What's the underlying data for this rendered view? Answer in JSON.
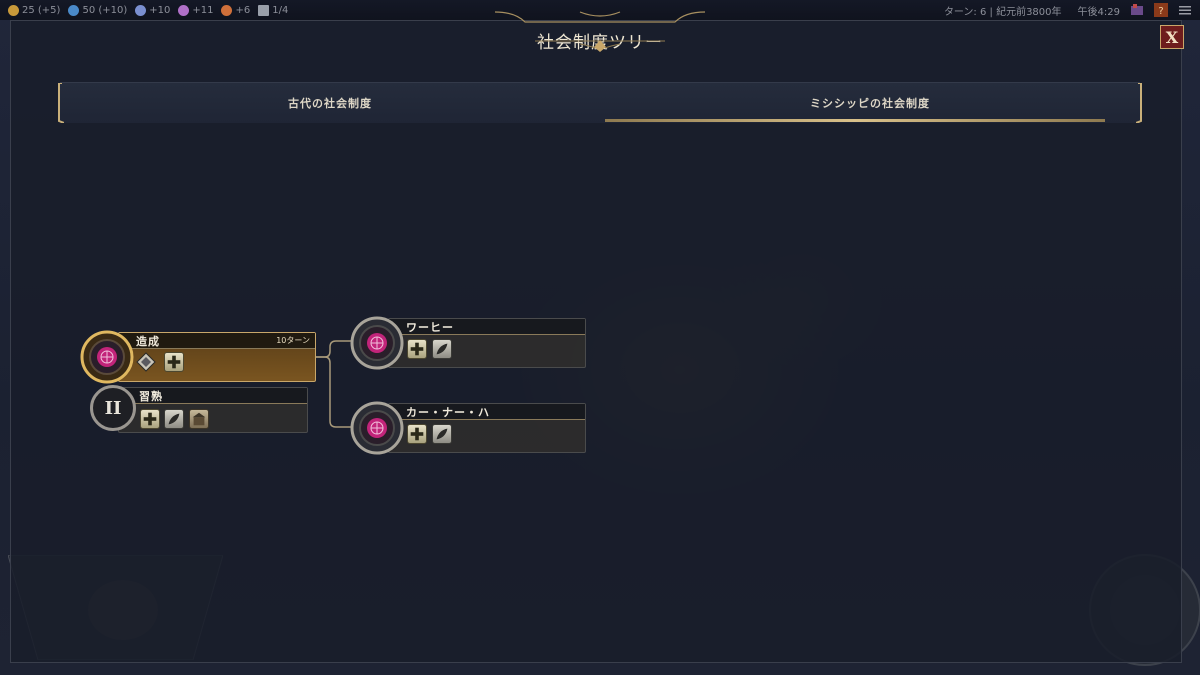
{
  "topbar": {
    "resources": [
      {
        "icon": "gold-icon",
        "value": "25 (+5)",
        "color": "#c99a3a"
      },
      {
        "icon": "science-icon",
        "value": "50 (+10)",
        "color": "#4a8ac9"
      },
      {
        "icon": "faith-icon",
        "value": "+10",
        "color": "#7a8fd0"
      },
      {
        "icon": "culture-icon",
        "value": "+11",
        "color": "#b070c8"
      },
      {
        "icon": "influence-icon",
        "value": "+6",
        "color": "#d0703a"
      },
      {
        "icon": "settlement-icon",
        "value": "1/4",
        "color": "#9aa0aa"
      }
    ],
    "turn_info": "ターン: 6 | 紀元前3800年",
    "clock": "午後4:29"
  },
  "panel": {
    "title": "社会制度ツリー",
    "close_label": "X"
  },
  "tabs": [
    {
      "label": "古代の社会制度",
      "active": false
    },
    {
      "label": "ミシシッピの社会制度",
      "active": true
    }
  ],
  "tree": {
    "root": {
      "name": "造成",
      "turns": "10ターン",
      "icon": "culture-globe-icon",
      "selected": true
    },
    "mastery": {
      "name": "習熟",
      "tier": "II"
    },
    "child1": {
      "name": "ワーヒー",
      "icon": "culture-globe-icon"
    },
    "child2": {
      "name": "カー・ナー・ハ",
      "icon": "culture-globe-icon"
    }
  },
  "colors": {
    "accent_gold": "#c9a76a",
    "node_selected": "#6b4a1c",
    "culture_magenta": "#c2247a",
    "close_red": "#6e1d1d"
  }
}
